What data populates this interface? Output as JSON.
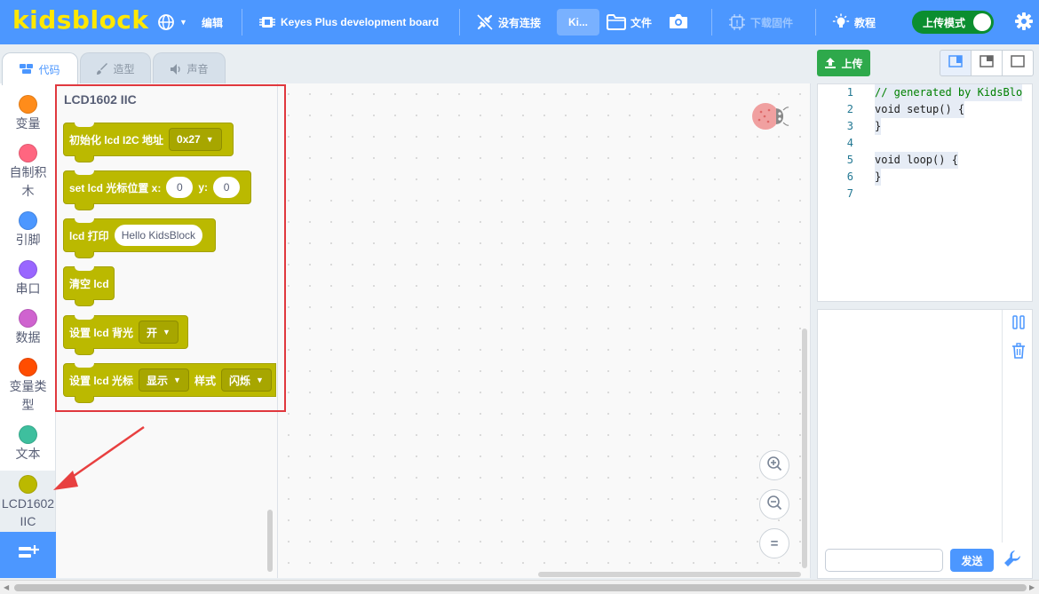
{
  "menubar": {
    "logo": "kidsblock",
    "edit": "编辑",
    "board": "Keyes Plus development board",
    "connection": "没有连接",
    "short_button": "Ki...",
    "file": "文件",
    "firmware": "下载固件",
    "tutorial": "教程",
    "upload_mode": "上传模式"
  },
  "tabs": {
    "code": "代码",
    "costumes": "造型",
    "sounds": "声音"
  },
  "categories": [
    {
      "label": "变量",
      "color": "#ff8c1a"
    },
    {
      "label": "自制积木",
      "color": "#ff6680"
    },
    {
      "label": "引脚",
      "color": "#4c97ff"
    },
    {
      "label": "串口",
      "color": "#9966ff"
    },
    {
      "label": "数据",
      "color": "#cf63cf"
    },
    {
      "label": "变量类型",
      "color": "#ff4d00"
    },
    {
      "label": "文本",
      "color": "#3ebf9e"
    },
    {
      "label": "LCD1602 IIC",
      "color": "#bbb900"
    }
  ],
  "flyout": {
    "title": "LCD1602 IIC",
    "blocks": {
      "init": {
        "text": "初始化 lcd I2C 地址",
        "value": "0x27"
      },
      "cursor": {
        "text": "set lcd 光标位置 x:",
        "x": "0",
        "ylabel": "y:",
        "y": "0"
      },
      "print": {
        "text": "lcd 打印",
        "value": "Hello KidsBlock"
      },
      "clear": {
        "text": "清空 lcd"
      },
      "backlight": {
        "text": "设置 lcd 背光",
        "value": "开"
      },
      "cursor_style": {
        "text": "设置 lcd 光标",
        "value1": "显示",
        "label2": "样式",
        "value2": "闪烁"
      }
    }
  },
  "right": {
    "upload": "上传",
    "send": "发送",
    "code_lines": [
      {
        "num": "1",
        "text": "// generated by KidsBlo",
        "type": "comment"
      },
      {
        "num": "2",
        "text": "void setup() {",
        "type": "code"
      },
      {
        "num": "3",
        "text": "}",
        "type": "code"
      },
      {
        "num": "4",
        "text": "",
        "type": "empty"
      },
      {
        "num": "5",
        "text": "void loop() {",
        "type": "code"
      },
      {
        "num": "6",
        "text": "}",
        "type": "code"
      },
      {
        "num": "7",
        "text": "",
        "type": "empty"
      }
    ]
  },
  "zoom": {
    "reset_symbol": "="
  }
}
